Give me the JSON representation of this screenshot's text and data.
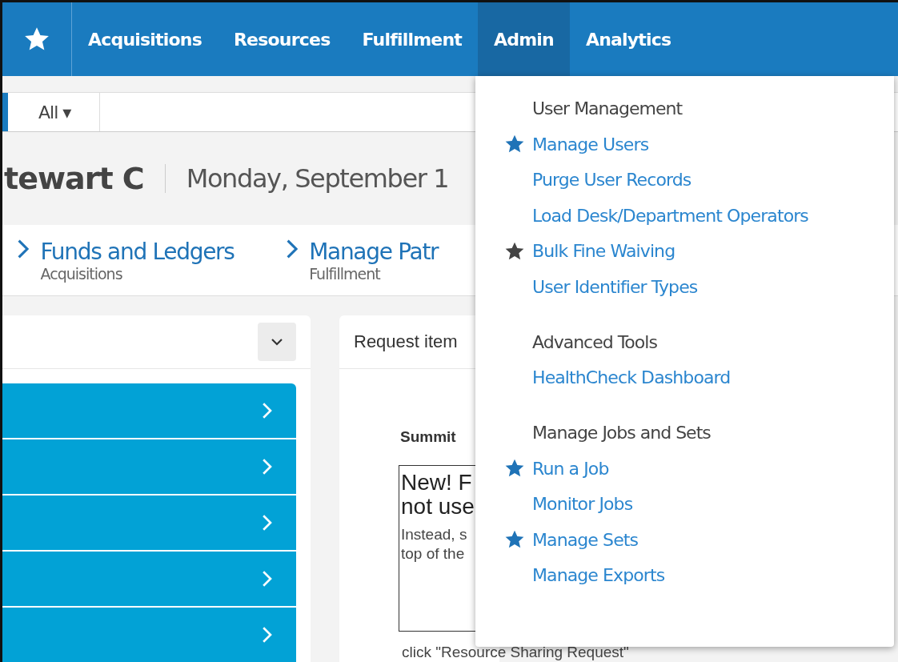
{
  "nav": {
    "tabs": [
      {
        "label": "Acquisitions",
        "selected": false
      },
      {
        "label": "Resources",
        "selected": false
      },
      {
        "label": "Fulfillment",
        "selected": false
      },
      {
        "label": "Admin",
        "selected": true
      },
      {
        "label": "Analytics",
        "selected": false
      }
    ]
  },
  "search": {
    "scope": "All ▾"
  },
  "header": {
    "user": "tewart C",
    "date": "Monday, September 1"
  },
  "favorites": [
    {
      "title": "Funds and Ledgers",
      "area": "Acquisitions"
    },
    {
      "title": "Manage Patr",
      "area": "Fulfillment"
    }
  ],
  "request_widget": {
    "title": "Request item",
    "subtitle": "Summit",
    "notice": [
      "New! F",
      "not use"
    ],
    "body": [
      "Instead, s",
      "top of the",
      "click \"Resource Sharing Request\""
    ]
  },
  "admin_menu": {
    "sections": [
      {
        "heading": "User Management",
        "items": [
          {
            "label": "Manage Users",
            "pinned": true,
            "hovered": false
          },
          {
            "label": "Purge User Records",
            "pinned": false,
            "hovered": false
          },
          {
            "label": "Load Desk/Department Operators",
            "pinned": false,
            "hovered": false
          },
          {
            "label": "Bulk Fine Waiving",
            "pinned": false,
            "hovered": true
          },
          {
            "label": "User Identifier Types",
            "pinned": false,
            "hovered": false
          }
        ]
      },
      {
        "heading": "Advanced Tools",
        "items": [
          {
            "label": "HealthCheck Dashboard",
            "pinned": false,
            "hovered": false
          }
        ]
      },
      {
        "heading": "Manage Jobs and Sets",
        "items": [
          {
            "label": "Run a Job",
            "pinned": true,
            "hovered": false
          },
          {
            "label": "Monitor Jobs",
            "pinned": false,
            "hovered": false
          },
          {
            "label": "Manage Sets",
            "pinned": true,
            "hovered": false
          },
          {
            "label": "Manage Exports",
            "pinned": false,
            "hovered": false
          }
        ]
      }
    ]
  }
}
